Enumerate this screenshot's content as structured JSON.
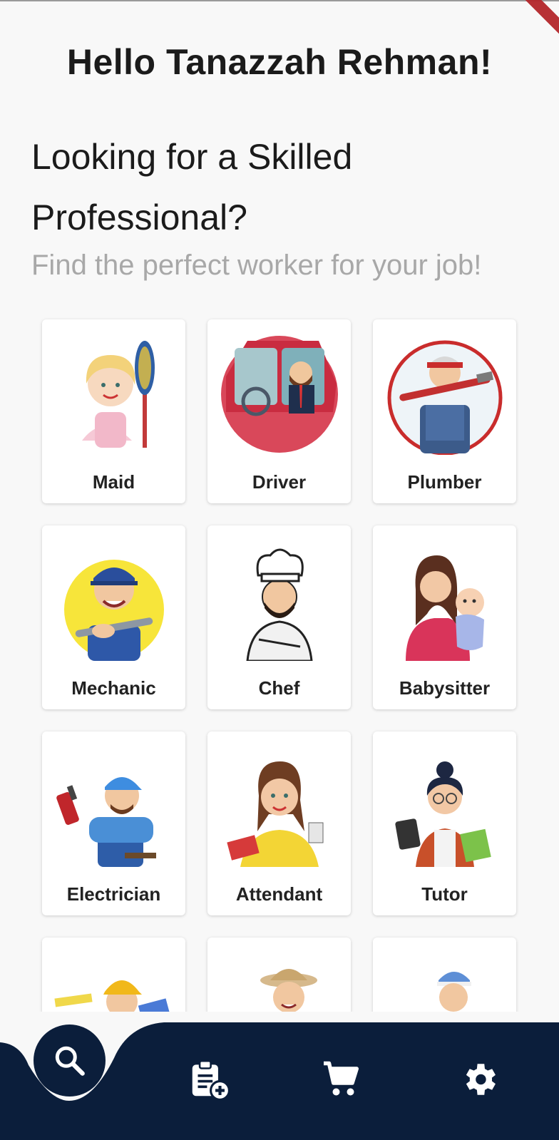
{
  "greeting": "Hello Tanazzah Rehman!",
  "headline": "Looking for a Skilled Professional?",
  "subheadline": "Find the perfect worker for your job!",
  "categories": [
    {
      "label": "Maid",
      "icon": "maid-illustration"
    },
    {
      "label": "Driver",
      "icon": "driver-illustration"
    },
    {
      "label": "Plumber",
      "icon": "plumber-illustration"
    },
    {
      "label": "Mechanic",
      "icon": "mechanic-illustration"
    },
    {
      "label": "Chef",
      "icon": "chef-illustration"
    },
    {
      "label": "Babysitter",
      "icon": "babysitter-illustration"
    },
    {
      "label": "Electrician",
      "icon": "electrician-illustration"
    },
    {
      "label": "Attendant",
      "icon": "attendant-illustration"
    },
    {
      "label": "Tutor",
      "icon": "tutor-illustration"
    },
    {
      "label": "",
      "icon": "painter-illustration"
    },
    {
      "label": "",
      "icon": "gardener-illustration"
    },
    {
      "label": "",
      "icon": "worker-illustration"
    }
  ],
  "bottom_nav": {
    "items": [
      {
        "icon": "search-icon",
        "active": true
      },
      {
        "icon": "clipboard-add-icon",
        "active": false
      },
      {
        "icon": "cart-icon",
        "active": false
      },
      {
        "icon": "gear-icon",
        "active": false
      }
    ]
  },
  "colors": {
    "nav_background": "#0b1e3b",
    "page_background": "#f8f8f8",
    "card_background": "#ffffff",
    "subheadline": "#a8a8a8"
  }
}
